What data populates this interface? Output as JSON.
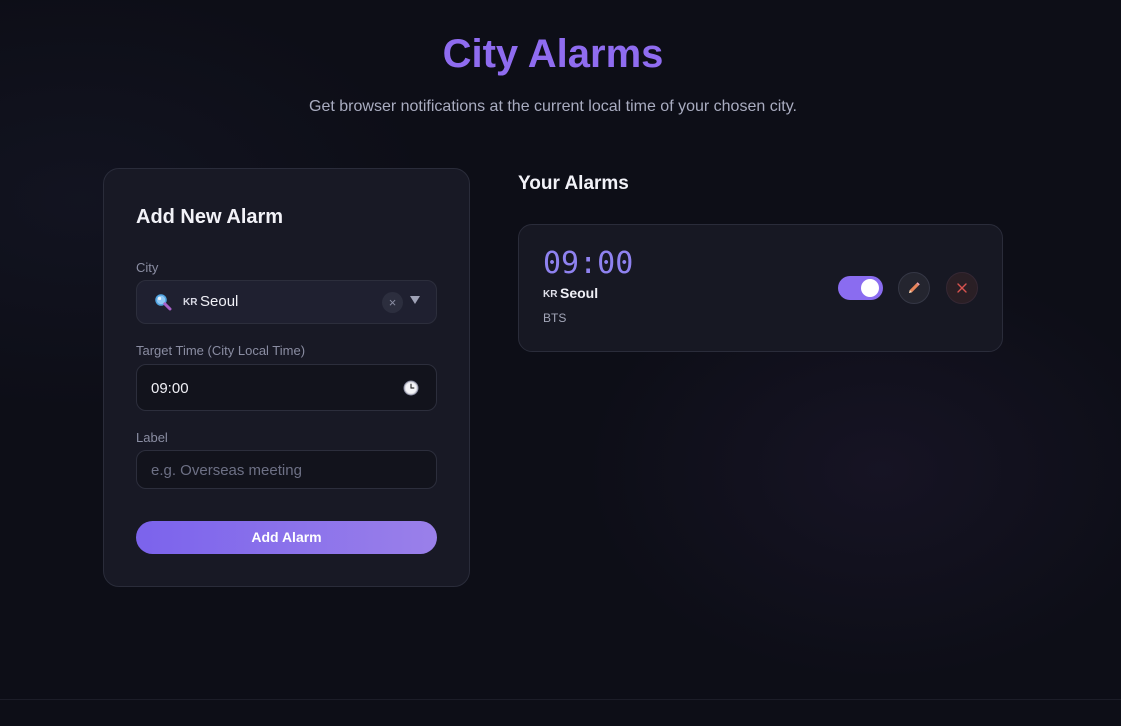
{
  "header": {
    "title": "City Alarms",
    "subtitle": "Get browser notifications at the current local time of your chosen city."
  },
  "form": {
    "title": "Add New Alarm",
    "city": {
      "label": "City",
      "country_code": "KR",
      "value": "Seoul",
      "clear_symbol": "×"
    },
    "time": {
      "label": "Target Time (City Local Time)",
      "value": "09:00"
    },
    "label_field": {
      "label": "Label",
      "placeholder": "e.g. Overseas meeting",
      "value": ""
    },
    "submit_label": "Add Alarm"
  },
  "alarms": {
    "title": "Your Alarms",
    "items": [
      {
        "time": "09:00",
        "country_code": "KR",
        "city": "Seoul",
        "label": "BTS",
        "enabled": true
      }
    ]
  },
  "colors": {
    "accent": "#8f6cf0",
    "background": "#0d0e17",
    "card": "#181925",
    "delete": "#d9534f",
    "edit": "#e8845a"
  },
  "icons": {
    "city_search": "magnifier-icon",
    "time": "clock-icon",
    "edit": "pencil-icon",
    "delete": "close-icon",
    "dropdown": "chevron-down-icon"
  }
}
